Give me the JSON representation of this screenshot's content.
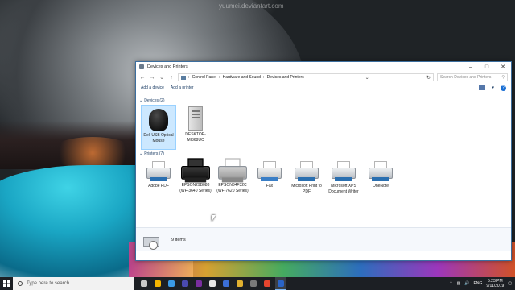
{
  "wallpaper": {
    "watermark": "yuumei.deviantart.com"
  },
  "window": {
    "title": "Devices and Printers",
    "breadcrumb": [
      "Control Panel",
      "Hardware and Sound",
      "Devices and Printers"
    ],
    "search_placeholder": "Search Devices and Printers",
    "commands": {
      "add_device": "Add a device",
      "add_printer": "Add a printer"
    },
    "groups": {
      "devices": {
        "header": "Devices (2)",
        "items": [
          {
            "label": "Dell USB Optical Mouse",
            "icon": "mouse-icon"
          },
          {
            "label": "DESKTOP-MI368UC",
            "icon": "computer-icon"
          }
        ]
      },
      "printers": {
        "header": "Printers (7)",
        "items": [
          {
            "label": "Adobe PDF",
            "icon": "printer-icon"
          },
          {
            "label": "EPSON29B088 (WF-3640 Series)",
            "icon": "printer-icon"
          },
          {
            "label": "EPSON34F32C (WF-7620 Series)",
            "icon": "printer-icon"
          },
          {
            "label": "Fax",
            "icon": "fax-icon"
          },
          {
            "label": "Microsoft Print to PDF",
            "icon": "printer-icon"
          },
          {
            "label": "Microsoft XPS Document Writer",
            "icon": "printer-icon"
          },
          {
            "label": "OneNote",
            "icon": "printer-icon"
          }
        ]
      }
    },
    "details": {
      "count": "9 items"
    }
  },
  "taskbar": {
    "search_placeholder": "Type here to search",
    "language": "ENG",
    "time": "5:23 PM",
    "date": "9/11/2019",
    "app_colors": [
      "#c9c9c9",
      "#f4b400",
      "#3a9ae6",
      "#4a4ab0",
      "#7a2ea0",
      "#e8e8e8",
      "#3b6fd8",
      "#e0b030",
      "#7a7a7a",
      "#e6452e",
      "#2a64c8"
    ]
  }
}
